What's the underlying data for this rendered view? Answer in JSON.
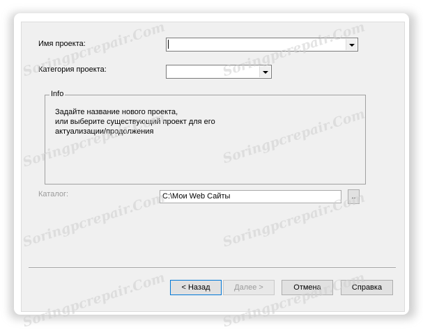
{
  "form": {
    "project_name_label": "Имя проекта:",
    "project_name_value": "",
    "project_category_label": "Категория проекта:",
    "project_category_value": ""
  },
  "info": {
    "legend": "Info",
    "line1": "Задайте название нового проекта,",
    "line2": "или выберите существующий проект для его",
    "line3": "актуализации/продолжения"
  },
  "catalog": {
    "label": "Каталог:",
    "value": "C:\\Мои Web Сайты",
    "browse_label": ".."
  },
  "buttons": {
    "back": "< Назад",
    "next": "Далее >",
    "cancel": "Отмена",
    "help": "Справка"
  },
  "watermark": "Soringpcrepair.Com",
  "icons": [
    "chevron-down-icon"
  ]
}
